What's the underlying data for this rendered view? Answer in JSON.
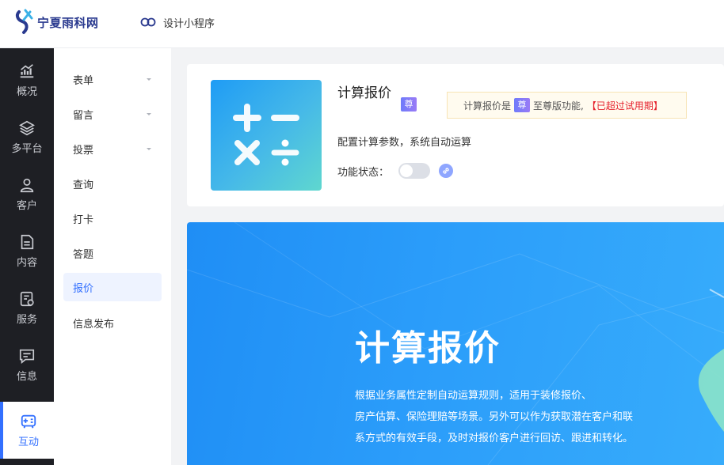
{
  "header": {
    "logo_text": "宁夏雨科网",
    "mini_program_label": "设计小程序"
  },
  "rail": {
    "items": [
      {
        "label": "概况",
        "icon": "chart-icon"
      },
      {
        "label": "多平台",
        "icon": "layers-icon"
      },
      {
        "label": "客户",
        "icon": "user-icon"
      },
      {
        "label": "内容",
        "icon": "document-icon"
      },
      {
        "label": "服务",
        "icon": "service-icon"
      },
      {
        "label": "信息",
        "icon": "message-icon"
      },
      {
        "label": "互动",
        "icon": "gamepad-icon",
        "active": true
      }
    ]
  },
  "submenu": {
    "items": [
      {
        "label": "表单",
        "has_children": true
      },
      {
        "label": "留言",
        "has_children": true
      },
      {
        "label": "投票",
        "has_children": true
      },
      {
        "label": "查询"
      },
      {
        "label": "打卡"
      },
      {
        "label": "答题"
      },
      {
        "label": "报价",
        "active": true
      },
      {
        "label": "信息发布"
      }
    ]
  },
  "feature": {
    "title": "计算报价",
    "badge": "尊",
    "description": "配置计算参数，系统自动运算",
    "status_label": "功能状态：",
    "enabled": false,
    "notice": {
      "prefix": "计算报价是",
      "badge": "尊",
      "suffix": "至尊版功能,",
      "expired": "【已超过试用期】"
    }
  },
  "hero": {
    "title": "计算报价",
    "lines": [
      "根据业务属性定制自动运算规则，适用于装修报价、",
      "房产估算、保险理赔等场景。另外可以作为获取潜在客户和联",
      "系方式的有效手段，及时对报价客户进行回访、跟进和转化。"
    ]
  },
  "colors": {
    "accent": "#3370ff",
    "rail_bg": "#1e1f24",
    "hero_bg": "#2b9dfa",
    "expired_text": "#e6222d"
  }
}
